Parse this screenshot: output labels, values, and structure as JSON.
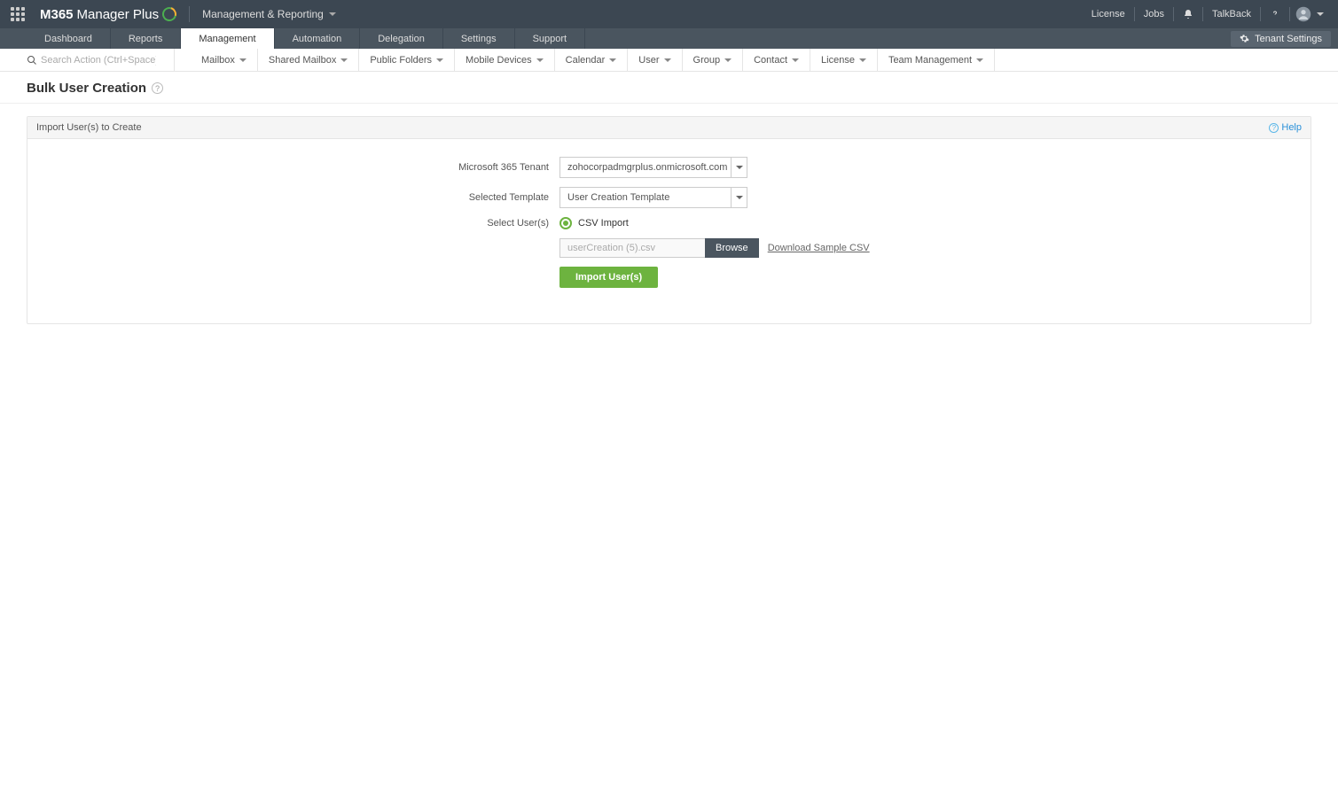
{
  "header": {
    "product_name_bold": "M365",
    "product_name_rest": "Manager Plus",
    "breadcrumb": "Management & Reporting",
    "links": {
      "license": "License",
      "jobs": "Jobs",
      "talkback": "TalkBack"
    }
  },
  "nav": {
    "tabs": [
      "Dashboard",
      "Reports",
      "Management",
      "Automation",
      "Delegation",
      "Settings",
      "Support"
    ],
    "active_index": 2,
    "tenant_settings": "Tenant Settings"
  },
  "subnav": {
    "search_placeholder": "Search Action (Ctrl+Space)",
    "items": [
      "Mailbox",
      "Shared Mailbox",
      "Public Folders",
      "Mobile Devices",
      "Calendar",
      "User",
      "Group",
      "Contact",
      "License",
      "Team Management"
    ]
  },
  "page": {
    "title": "Bulk User Creation"
  },
  "panel": {
    "header": "Import User(s) to Create",
    "help": "Help",
    "form": {
      "tenant_label": "Microsoft 365 Tenant",
      "tenant_value": "zohocorpadmgrplus.onmicrosoft.com",
      "template_label": "Selected Template",
      "template_value": "User Creation Template",
      "select_users_label": "Select User(s)",
      "csv_import": "CSV Import",
      "file_value": "userCreation (5).csv",
      "browse": "Browse",
      "download_sample": "Download Sample CSV",
      "import_btn": "Import User(s)"
    }
  }
}
